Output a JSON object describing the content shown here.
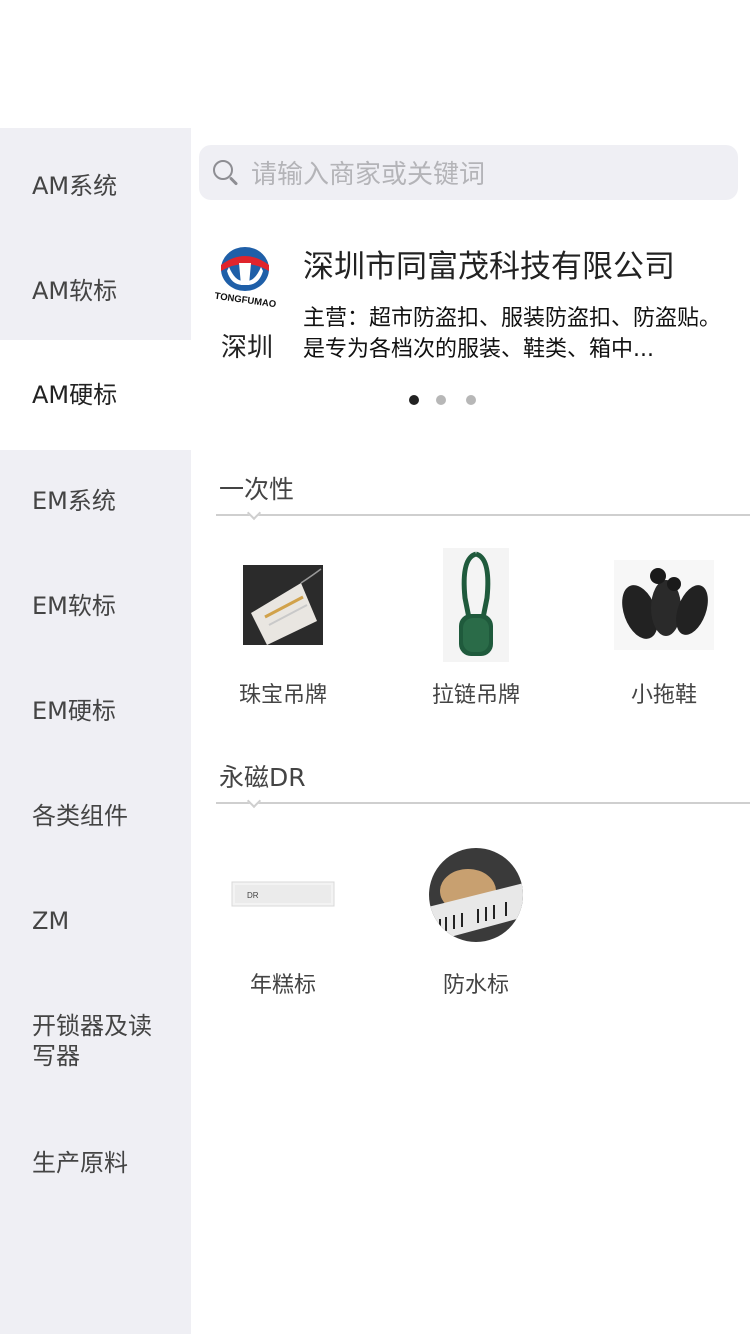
{
  "sidebar": {
    "items": [
      {
        "label": "AM系统"
      },
      {
        "label": "AM软标"
      },
      {
        "label": "AM硬标"
      },
      {
        "label": "EM系统"
      },
      {
        "label": "EM软标"
      },
      {
        "label": "EM硬标"
      },
      {
        "label": "各类组件"
      },
      {
        "label": "ZM"
      },
      {
        "label": "开锁器及读写器"
      },
      {
        "label": "生产原料"
      }
    ],
    "active_label": "AM硬标"
  },
  "search": {
    "placeholder": "请输入商家或关键词"
  },
  "merchant": {
    "logo_text": "TONGFUMAO",
    "city": "深圳",
    "name": "深圳市同富茂科技有限公司",
    "description": "主营：超市防盗扣、服装防盗扣、防盗贴。是专为各档次的服装、鞋类、箱中..."
  },
  "carousel": {
    "count": 3,
    "active_index": 0
  },
  "sections": [
    {
      "title": "一次性",
      "products": [
        {
          "label": "珠宝吊牌",
          "icon": "jewelry-tag-image"
        },
        {
          "label": "拉链吊牌",
          "icon": "zipper-tag-image"
        },
        {
          "label": "小拖鞋",
          "icon": "slipper-tag-image"
        }
      ]
    },
    {
      "title": "永磁DR",
      "products": [
        {
          "label": "年糕标",
          "icon": "dr-label-image",
          "image_text": "DR"
        },
        {
          "label": "防水标",
          "icon": "barcode-roll-image"
        }
      ]
    }
  ]
}
